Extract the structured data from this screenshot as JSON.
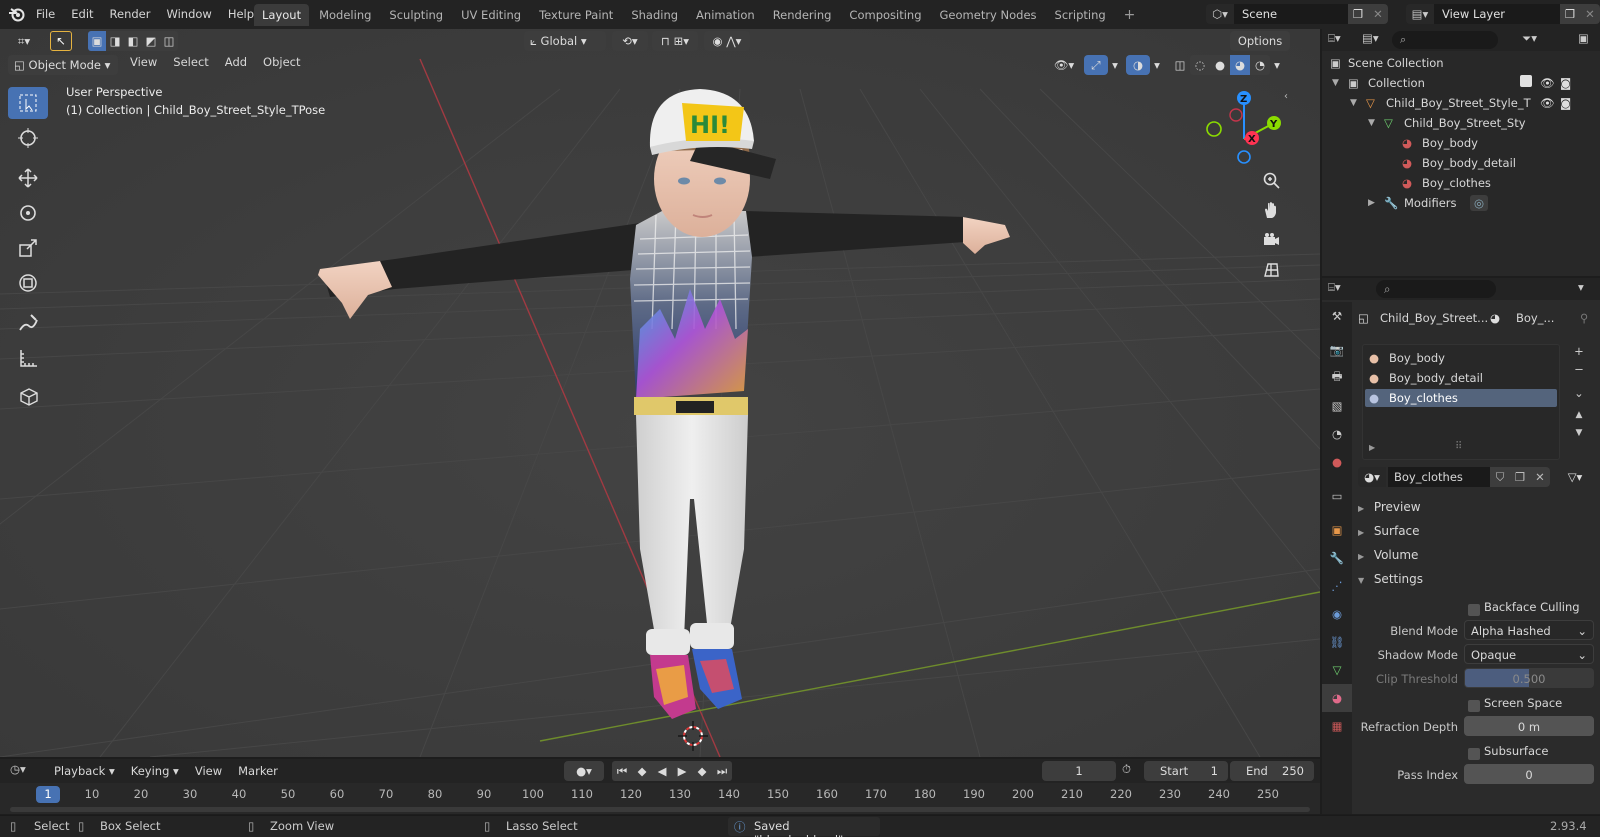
{
  "menu": [
    "File",
    "Edit",
    "Render",
    "Window",
    "Help"
  ],
  "workspaces": [
    "Layout",
    "Modeling",
    "Sculpting",
    "UV Editing",
    "Texture Paint",
    "Shading",
    "Animation",
    "Rendering",
    "Compositing",
    "Geometry Nodes",
    "Scripting"
  ],
  "scene": "Scene",
  "view_layer": "View Layer",
  "viewport": {
    "mode": "Object Mode",
    "menus": [
      "View",
      "Select",
      "Add",
      "Object"
    ],
    "transform_orientation": "Global",
    "options": "Options",
    "perspective": "User Perspective",
    "collection_info": "(1) Collection | Child_Boy_Street_Style_TPose",
    "cap_text": "HI!"
  },
  "outliner": {
    "scene_collection": "Scene Collection",
    "collection": "Collection",
    "object": "Child_Boy_Street_Style_T",
    "mesh": "Child_Boy_Street_Sty",
    "materials": [
      "Boy_body",
      "Boy_body_detail",
      "Boy_clothes"
    ],
    "modifiers": "Modifiers"
  },
  "properties": {
    "breadcrumb_object": "Child_Boy_Street...",
    "breadcrumb_material": "Boy_...",
    "slots": [
      "Boy_body",
      "Boy_body_detail",
      "Boy_clothes"
    ],
    "active_material": "Boy_clothes",
    "panels": [
      "Preview",
      "Surface",
      "Volume",
      "Settings"
    ],
    "backface_culling": "Backface Culling",
    "blend_mode_label": "Blend Mode",
    "blend_mode": "Alpha Hashed",
    "shadow_mode_label": "Shadow Mode",
    "shadow_mode": "Opaque",
    "clip_threshold_label": "Clip Threshold",
    "clip_threshold": "0.500",
    "screen_space_refraction": "Screen Space Refract...",
    "refraction_depth_label": "Refraction Depth",
    "refraction_depth": "0 m",
    "subsurface": "Subsurface Transluce...",
    "pass_index_label": "Pass Index",
    "pass_index": "0"
  },
  "timeline": {
    "menus": [
      "Playback",
      "Keying",
      "View",
      "Marker"
    ],
    "current_frame": "1",
    "start_label": "Start",
    "start": "1",
    "end_label": "End",
    "end": "250",
    "ruler": [
      "1",
      "10",
      "20",
      "30",
      "40",
      "50",
      "60",
      "70",
      "80",
      "90",
      "100",
      "110",
      "120",
      "130",
      "140",
      "150",
      "160",
      "170",
      "180",
      "190",
      "200",
      "210",
      "220",
      "230",
      "240",
      "250"
    ]
  },
  "status": {
    "select": "Select",
    "box_select": "Box Select",
    "zoom_view": "Zoom View",
    "lasso_select": "Lasso Select",
    "message": "Saved \"blender.blend\"",
    "version": "2.93.4"
  },
  "colors": {
    "accent": "#4772b3",
    "x_axis": "#ff3352",
    "y_axis": "#8bdc00",
    "z_axis": "#2890ff"
  }
}
